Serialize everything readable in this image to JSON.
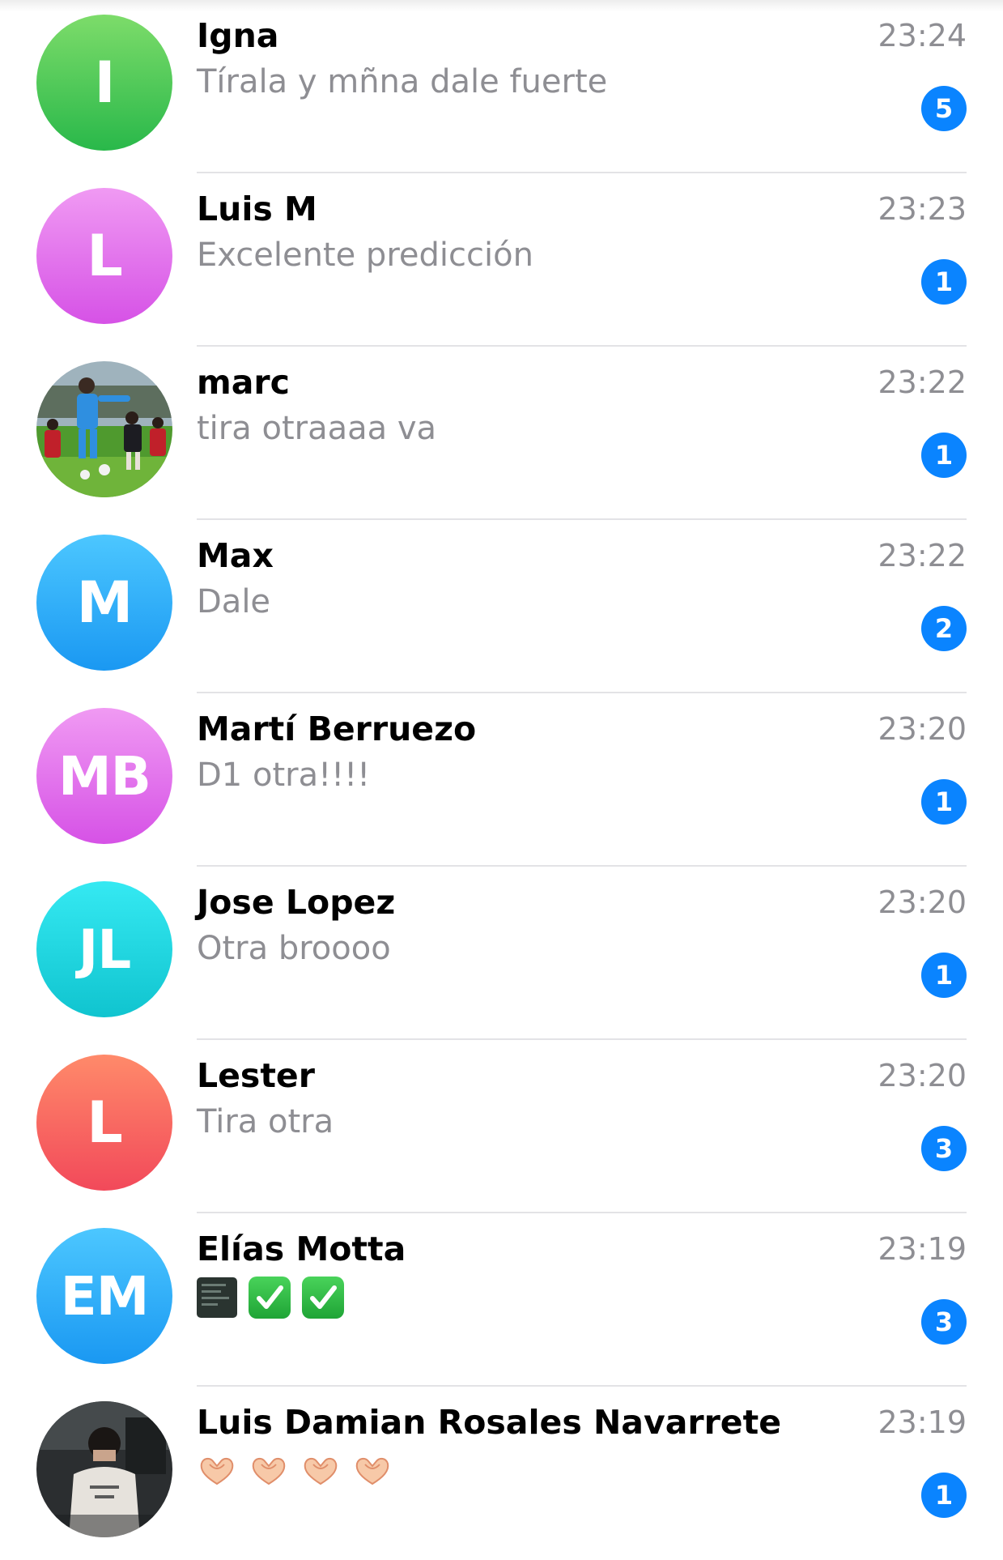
{
  "chats": [
    {
      "name": "Igna",
      "preview": "Tírala y mñna dale fuerte",
      "time": "23:24",
      "unread": "5",
      "avatar": {
        "type": "initials",
        "initials": "I",
        "colors": [
          "#7ddc6a",
          "#29b84a"
        ]
      }
    },
    {
      "name": "Luis M",
      "preview": "Excelente predicción",
      "time": "23:23",
      "unread": "1",
      "avatar": {
        "type": "initials",
        "initials": "L",
        "colors": [
          "#f09af3",
          "#d652e6"
        ]
      }
    },
    {
      "name": "marc",
      "preview": "tira otraaaa va",
      "time": "23:22",
      "unread": "1",
      "avatar": {
        "type": "photo",
        "description_icon": "football-training-photo-icon"
      }
    },
    {
      "name": "Max",
      "preview": "Dale",
      "time": "23:22",
      "unread": "2",
      "avatar": {
        "type": "initials",
        "initials": "M",
        "colors": [
          "#4cc7ff",
          "#1a98f2"
        ]
      }
    },
    {
      "name": "Martí Berruezo",
      "preview": "D1 otra!!!!",
      "time": "23:20",
      "unread": "1",
      "avatar": {
        "type": "initials",
        "initials": "MB",
        "colors": [
          "#f09af3",
          "#d652e6"
        ]
      }
    },
    {
      "name": "Jose Lopez",
      "preview": "Otra broooo",
      "time": "23:20",
      "unread": "1",
      "avatar": {
        "type": "initials",
        "initials": "JL",
        "colors": [
          "#35e9f2",
          "#10c4cf"
        ]
      }
    },
    {
      "name": "Lester",
      "preview": "Tira otra",
      "time": "23:20",
      "unread": "3",
      "avatar": {
        "type": "initials",
        "initials": "L",
        "colors": [
          "#ff8a6a",
          "#f2495a"
        ]
      }
    },
    {
      "name": "Elías Motta",
      "preview_icons": [
        "image-thumbnail-icon",
        "check-mark-button-icon",
        "check-mark-button-icon"
      ],
      "time": "23:19",
      "unread": "3",
      "avatar": {
        "type": "initials",
        "initials": "EM",
        "colors": [
          "#4cc7ff",
          "#1a98f2"
        ]
      }
    },
    {
      "name": "Luis Damian Rosales Navarrete",
      "preview_icons": [
        "heart-hands-icon",
        "heart-hands-icon",
        "heart-hands-icon",
        "heart-hands-icon"
      ],
      "time": "23:19",
      "unread": "1",
      "avatar": {
        "type": "photo",
        "description_icon": "person-photo-icon"
      }
    }
  ],
  "theme": {
    "badge_color": "#0a84ff",
    "time_color": "#8e8e93",
    "preview_color": "#8e8e93",
    "separator_color": "#e3e3e6"
  }
}
